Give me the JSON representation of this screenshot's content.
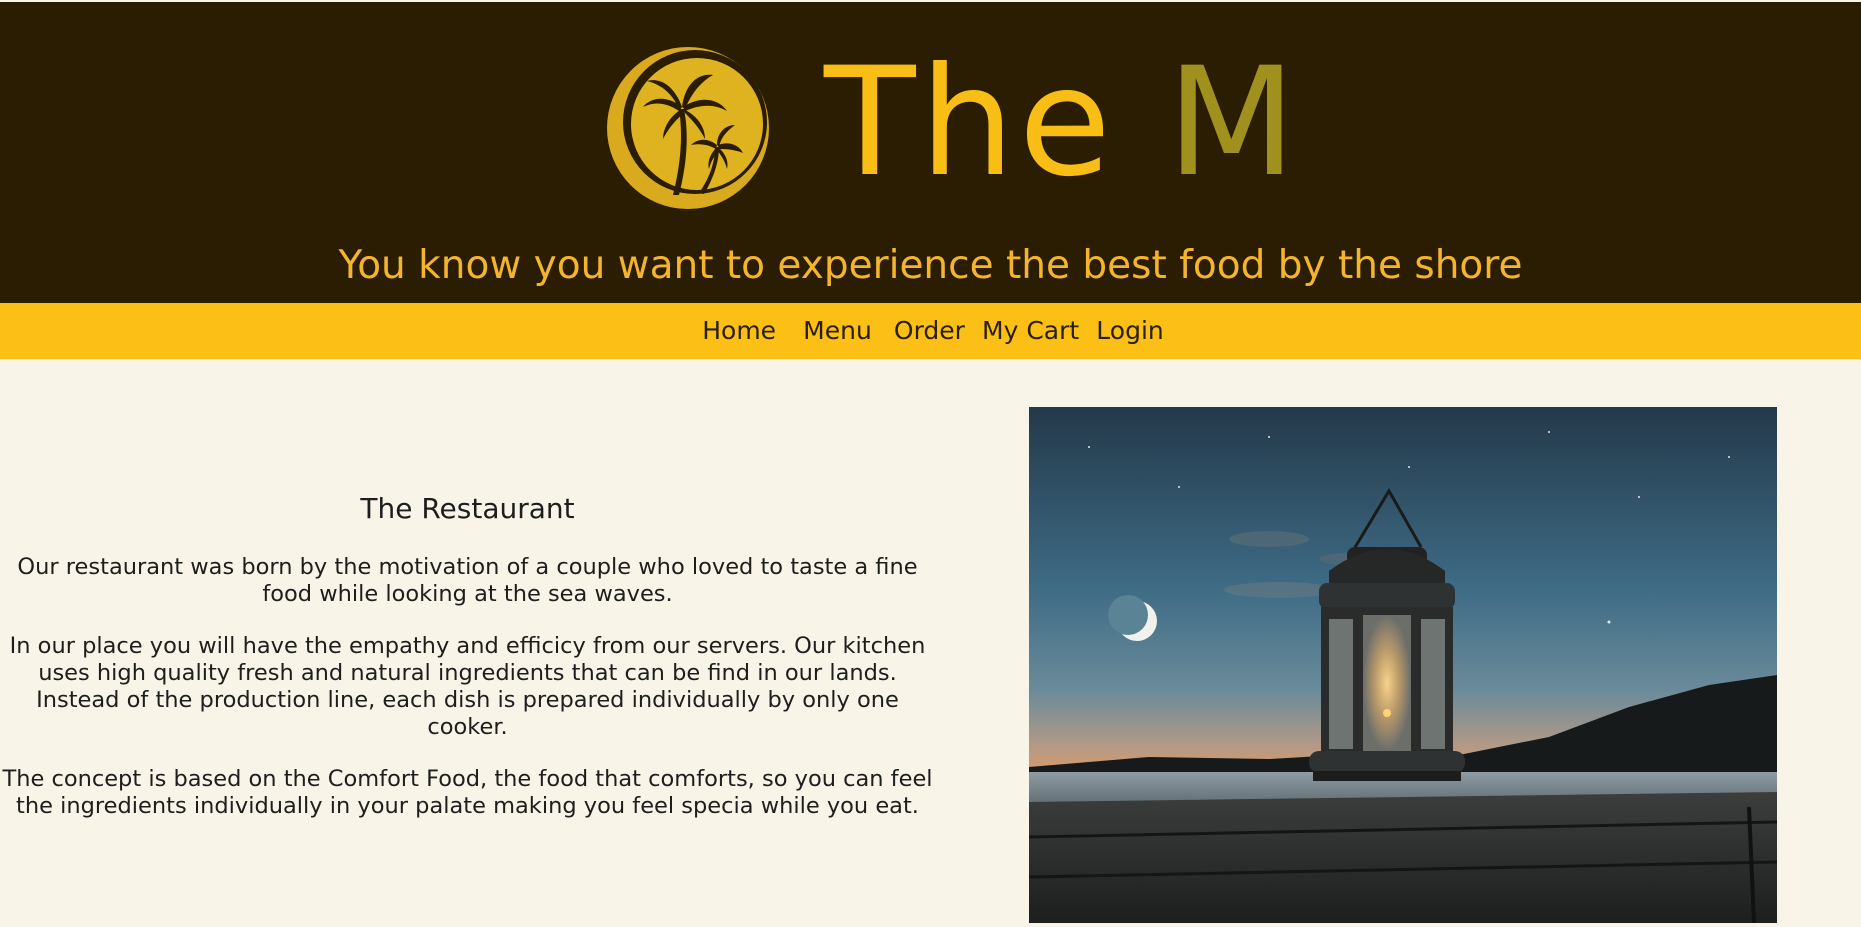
{
  "brand": {
    "logo_icon": "palm-tree-moon-icon",
    "name_part1": "The",
    "name_part2": "M"
  },
  "header": {
    "tagline": "You know you want to experience the best food by the shore"
  },
  "nav": {
    "items": [
      {
        "label": "Home"
      },
      {
        "label": "Menu"
      },
      {
        "label": "Order"
      },
      {
        "label": "My Cart"
      },
      {
        "label": "Login"
      }
    ]
  },
  "about": {
    "title": "The Restaurant",
    "paragraphs": [
      "Our restaurant was born by the motivation of a couple who loved to taste a fine food while looking at the sea waves.",
      "In our place you will have the empathy and efficicy from our servers. Our kitchen uses high quality fresh and natural ingredients that can be find in our lands. Instead of the production line, each dish is prepared individually by only one cooker.",
      "The concept is based on the Comfort Food, the food that comforts, so you can feel the ingredients individually in your palate making you feel specia while you eat."
    ]
  },
  "image": {
    "icon": "lantern-photo"
  },
  "colors": {
    "header_bg": "#2a1d02",
    "accent_yellow": "#fbbf15",
    "olive": "#a0911f",
    "tagline": "#f4b52d",
    "page_bg": "#f9f4e8"
  }
}
